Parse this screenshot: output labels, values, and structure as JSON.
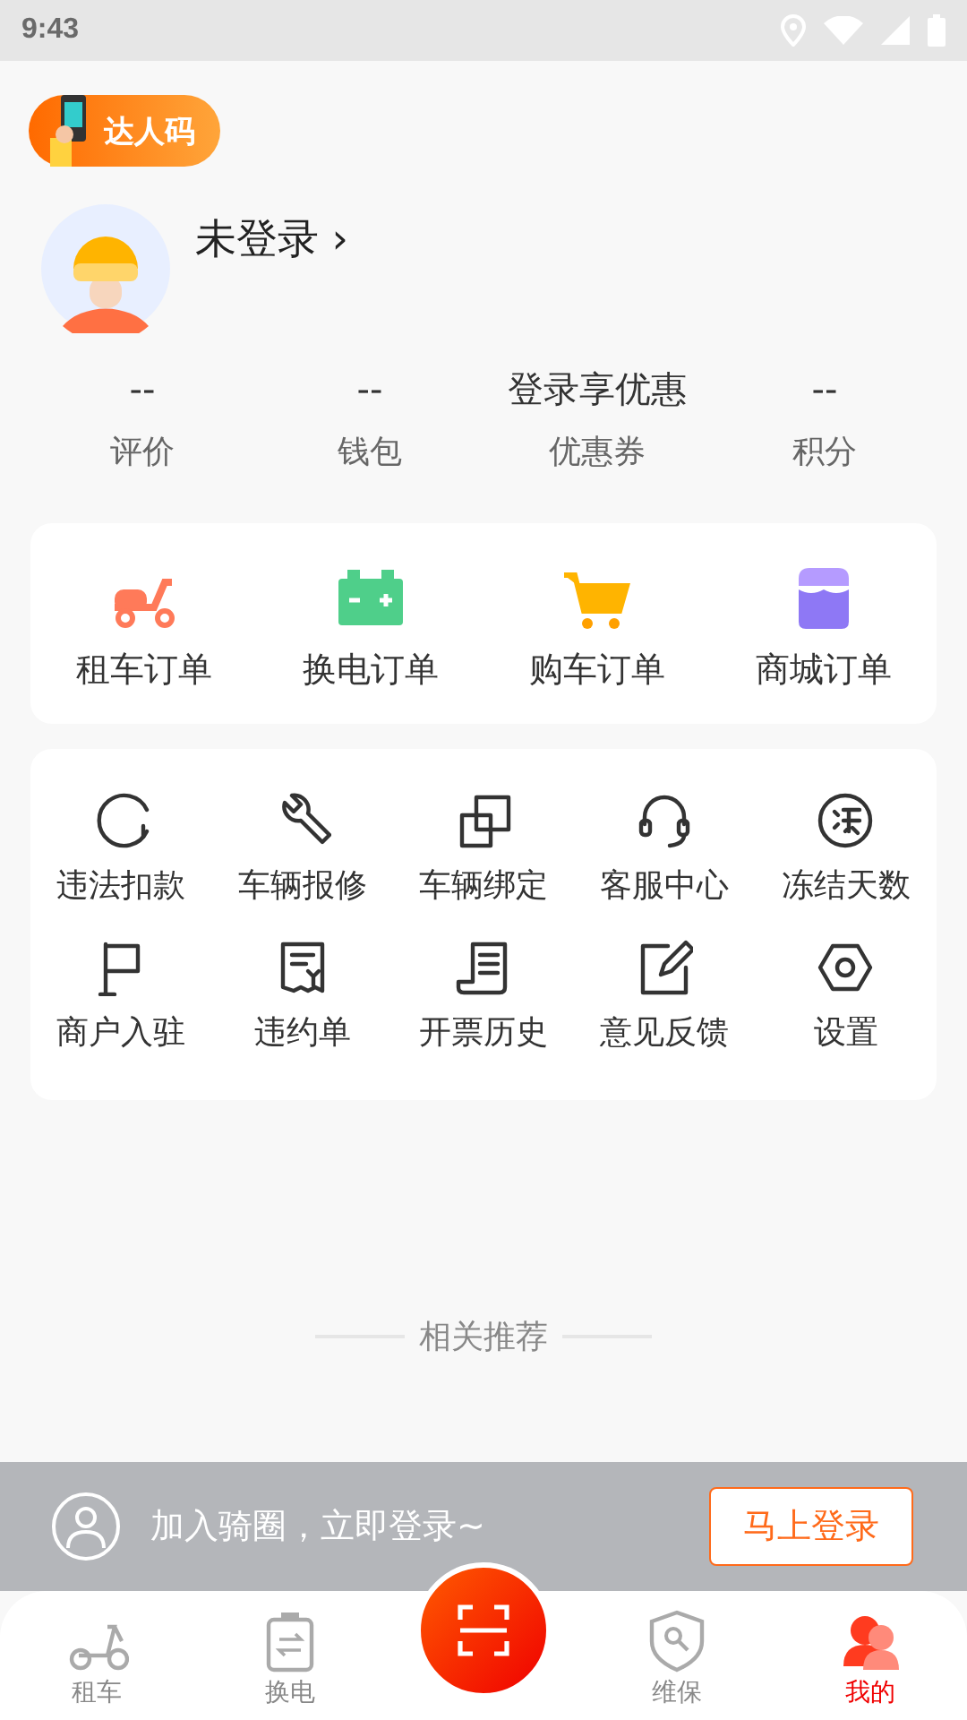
{
  "status_bar": {
    "time": "9:43"
  },
  "promo_badge": {
    "label": "达人码"
  },
  "profile": {
    "name": "未登录",
    "chevron": "›"
  },
  "stats": [
    {
      "value": "--",
      "label": "评价"
    },
    {
      "value": "--",
      "label": "钱包"
    },
    {
      "value": "登录享优惠",
      "label": "优惠券"
    },
    {
      "value": "--",
      "label": "积分"
    }
  ],
  "orders": [
    {
      "label": "租车订单"
    },
    {
      "label": "换电订单"
    },
    {
      "label": "购车订单"
    },
    {
      "label": "商城订单"
    }
  ],
  "services": [
    {
      "label": "违法扣款"
    },
    {
      "label": "车辆报修"
    },
    {
      "label": "车辆绑定"
    },
    {
      "label": "客服中心"
    },
    {
      "label": "冻结天数"
    },
    {
      "label": "商户入驻"
    },
    {
      "label": "违约单"
    },
    {
      "label": "开票历史"
    },
    {
      "label": "意见反馈"
    },
    {
      "label": "设置"
    }
  ],
  "recommend_heading": "相关推荐",
  "login_bar": {
    "text": "加入骑圈，立即登录~",
    "button": "马上登录"
  },
  "nav": [
    {
      "kind": "tab",
      "label": "租车",
      "selected": false
    },
    {
      "kind": "tab",
      "label": "换电",
      "selected": false
    },
    {
      "kind": "scan"
    },
    {
      "kind": "tab",
      "label": "维保",
      "selected": false
    },
    {
      "kind": "tab",
      "label": "我的",
      "selected": true
    }
  ]
}
